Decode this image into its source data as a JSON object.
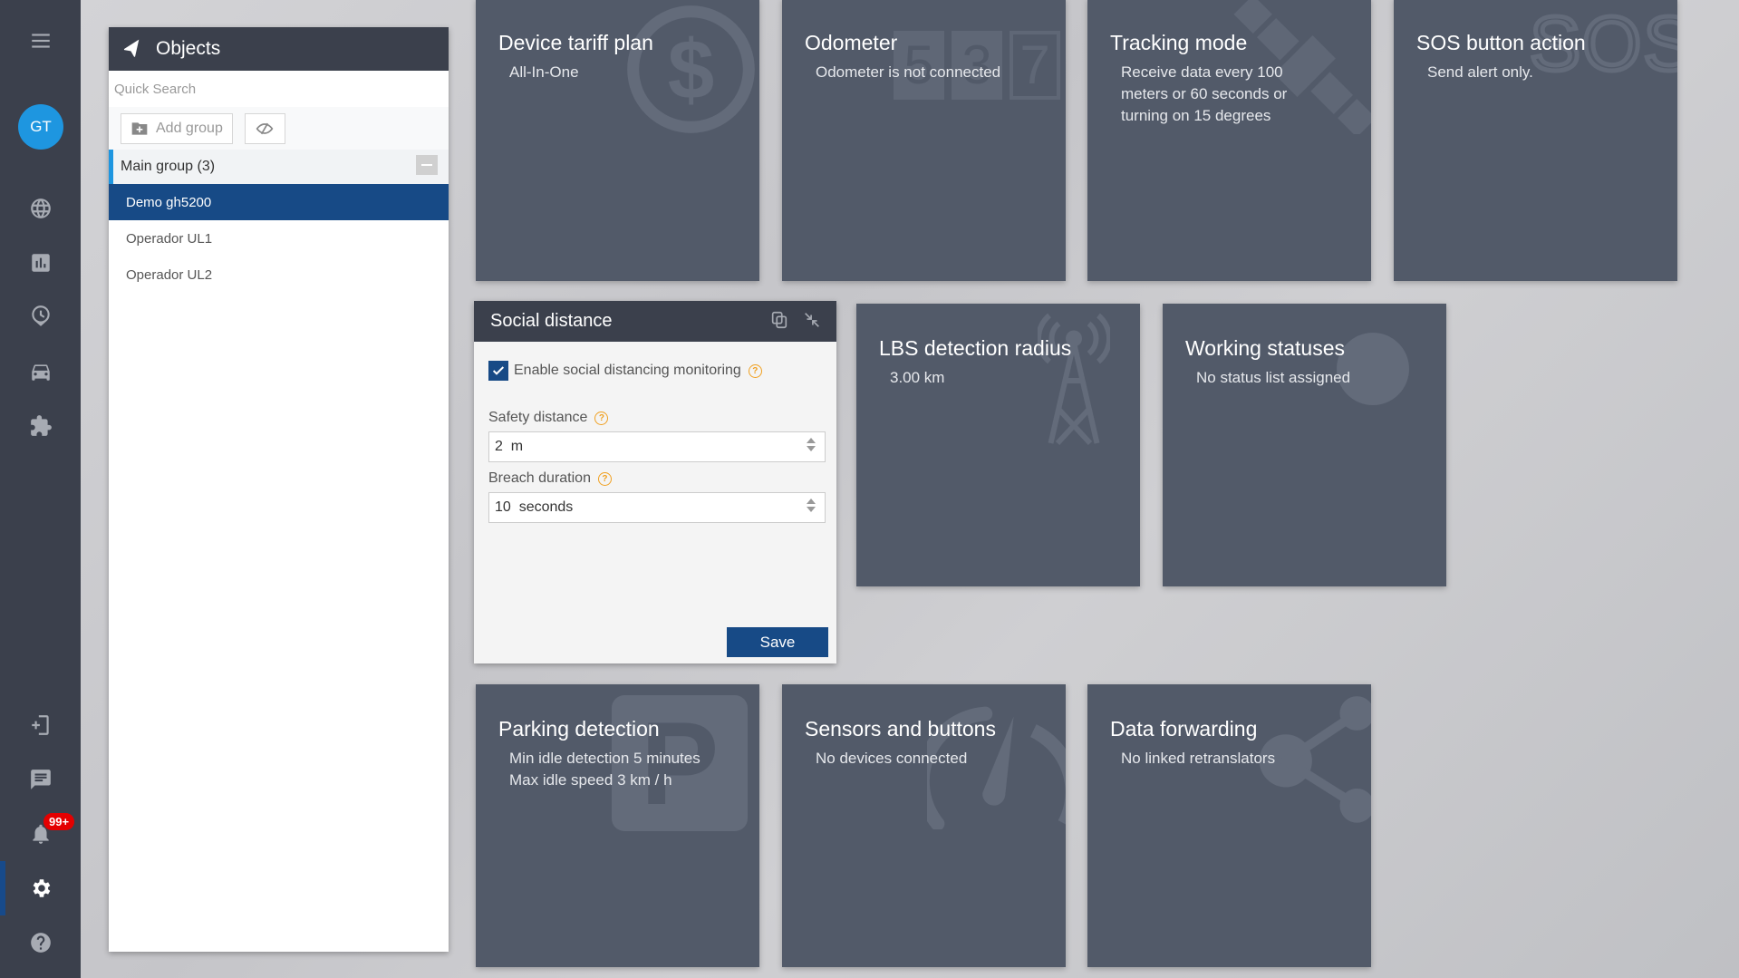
{
  "sidebar": {
    "avatar_initials": "GT",
    "notification_count": "99+",
    "items": [
      {
        "name": "menu",
        "icon": "hamburger-icon"
      },
      {
        "name": "map",
        "icon": "globe-icon"
      },
      {
        "name": "reports",
        "icon": "chart-icon"
      },
      {
        "name": "history",
        "icon": "clock-pin-icon"
      },
      {
        "name": "vehicles",
        "icon": "car-icon"
      },
      {
        "name": "apps",
        "icon": "puzzle-icon"
      },
      {
        "name": "add-device",
        "icon": "add-device-icon"
      },
      {
        "name": "messages",
        "icon": "chat-icon"
      },
      {
        "name": "notifications",
        "icon": "bell-icon"
      },
      {
        "name": "settings",
        "icon": "gear-icon",
        "active": true
      },
      {
        "name": "help",
        "icon": "help-icon"
      }
    ]
  },
  "objects": {
    "title": "Objects",
    "search_placeholder": "Quick Search",
    "add_group_label": "Add group",
    "group": {
      "label": "Main group (3)"
    },
    "items": [
      {
        "label": "Demo gh5200",
        "selected": true
      },
      {
        "label": "Operador UL1",
        "selected": false
      },
      {
        "label": "Operador UL2",
        "selected": false
      }
    ]
  },
  "tiles": [
    {
      "title": "Device tariff plan",
      "lines": [
        "All-In-One"
      ],
      "icon": "dollar-icon"
    },
    {
      "title": "Odometer",
      "lines": [
        "Odometer is not connected"
      ],
      "icon": "odometer-digits-icon",
      "digits": [
        "5",
        "3",
        "7"
      ]
    },
    {
      "title": "Tracking mode",
      "lines": [
        "Receive data every 100",
        "meters or 60 seconds or",
        "turning on 15 degrees"
      ],
      "icon": "satellite-icon"
    },
    {
      "title": "SOS button action",
      "lines": [
        "Send alert only."
      ],
      "icon": "sos-icon",
      "icon_text": "SOS"
    },
    {
      "title": "LBS detection radius",
      "lines": [
        "3.00 km"
      ],
      "icon": "cell-tower-icon"
    },
    {
      "title": "Working statuses",
      "lines": [
        "No status list assigned"
      ],
      "icon": "status-circle-icon"
    },
    {
      "title": "Parking detection",
      "lines": [
        "Min idle detection 5 minutes",
        "Max idle speed 3 km / h"
      ],
      "icon": "parking-icon",
      "icon_text": "P"
    },
    {
      "title": "Sensors and buttons",
      "lines": [
        "No devices connected"
      ],
      "icon": "gauge-icon"
    },
    {
      "title": "Data forwarding",
      "lines": [
        "No linked retranslators"
      ],
      "icon": "share-icon"
    }
  ],
  "social_distance": {
    "title": "Social distance",
    "enable_label": "Enable social distancing monitoring",
    "enabled": true,
    "safety_distance_label": "Safety distance",
    "safety_distance_value": "2  m",
    "breach_duration_label": "Breach duration",
    "breach_duration_value": "10  seconds",
    "save_label": "Save",
    "help_glyph": "?"
  },
  "colors": {
    "sidebar": "#3b404c",
    "accent": "#174a86",
    "avatar": "#1e96e0",
    "tile": "#525a69",
    "help": "#f0a020",
    "badge": "#e40000"
  }
}
